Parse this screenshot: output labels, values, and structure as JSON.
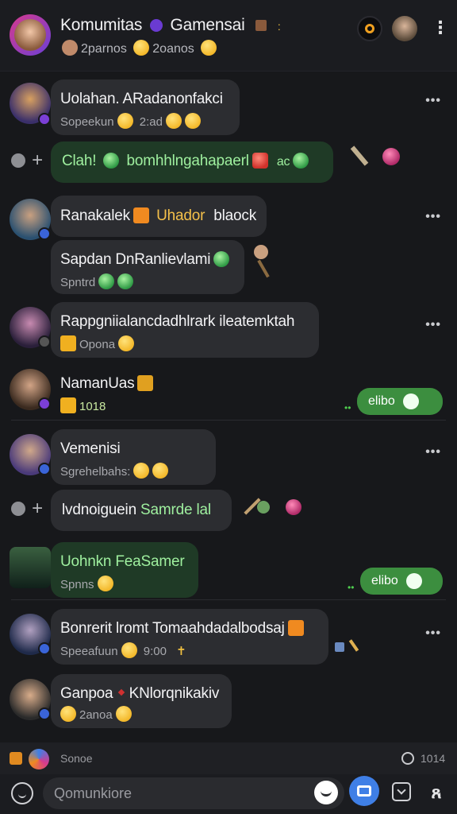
{
  "header": {
    "title": "Komumitas",
    "title_tail": "Gamensai",
    "subtitle_a": "2parnos",
    "subtitle_b": "2oanos"
  },
  "messages": [
    {
      "name": "Uolahan. ARadanonfakci",
      "sub": "Sopeekun",
      "time": "2:ad"
    },
    {
      "name": "Clah! ",
      "name_tail": "bomhhlngahapaerl",
      "tag": "ac",
      "green": true
    },
    {
      "name": "Ranakalek",
      "name_tail": "Uhador",
      "tag": "blaock"
    },
    {
      "name": "Sapdan DnRanlievlami",
      "sub": "Spntrd"
    },
    {
      "name": "Rappgniialancdadhlrark ileatemktah",
      "sub": "Opona"
    },
    {
      "name": "NamanUas",
      "sub": "1018"
    },
    {
      "name": "Vemenisi",
      "sub": "Sgrehelbahs:"
    },
    {
      "name": "lvdnoiguein",
      "name_tail": "Samrde lal"
    },
    {
      "name": "Uohnkn FeaSamer",
      "sub": "Spnns",
      "green": true
    },
    {
      "name": "Bonrerit lromt Tomaahdadalbodsaj",
      "sub": "Speeafuun",
      "time": "9:00"
    },
    {
      "name": "Ganpoa",
      "name_tail": "KNlorqnikakiv",
      "sub": "2anoa"
    }
  ],
  "pills": [
    "elibo",
    "elibo"
  ],
  "status": {
    "left": "Sonoe",
    "right": "1014"
  },
  "composer": {
    "placeholder": "Qomunkiore"
  },
  "colors": {
    "accent": "#3c8e3f",
    "send": "#3f7fe6",
    "bg": "#17181b"
  }
}
